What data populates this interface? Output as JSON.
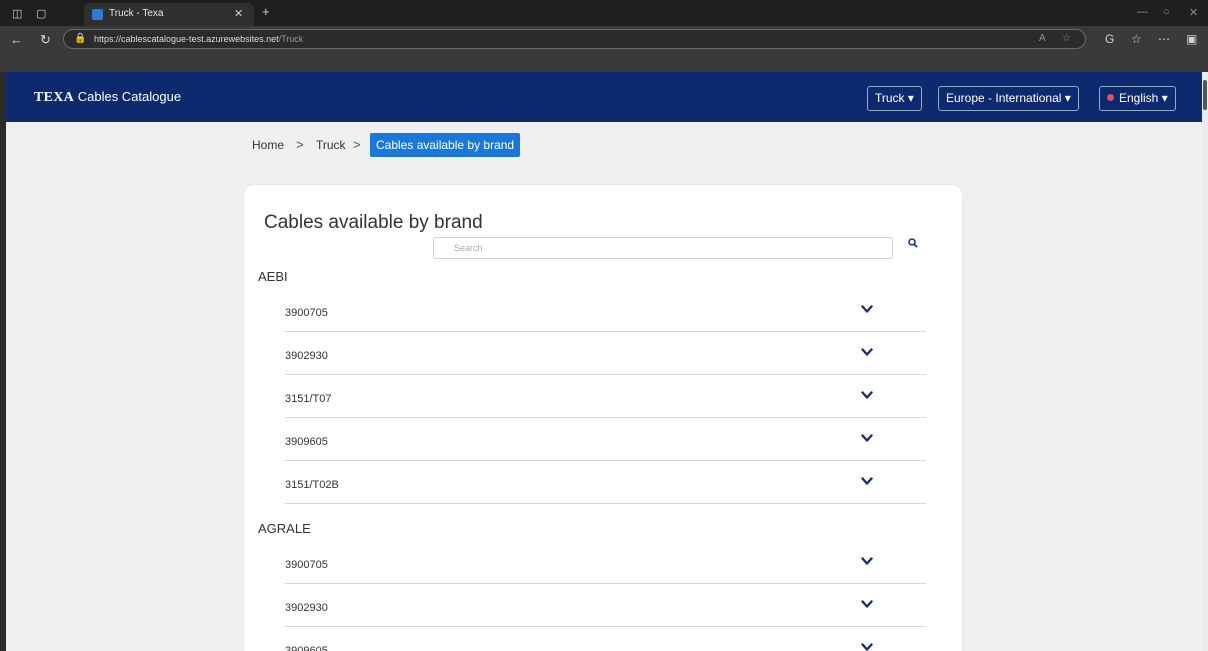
{
  "browser": {
    "tab_title": "Truck - Texa",
    "url_host": "https://cablescatalogue-test.azurewebsites.net",
    "url_path": "/Truck"
  },
  "header": {
    "brand_bold": "TEXA",
    "brand_rest": " Cables Catalogue",
    "vehicle_select": "Truck ▾",
    "region_select": "Europe - International ▾",
    "language_select": "English ▾"
  },
  "breadcrumb": {
    "home": "Home",
    "truck": "Truck",
    "separator": ">",
    "current": "Cables available by brand"
  },
  "card": {
    "title": "Cables available by brand",
    "search_placeholder": "Search"
  },
  "brands": [
    {
      "name": "AEBI",
      "cables": [
        "3900705",
        "3902930",
        "3151/T07",
        "3909605",
        "3151/T02B"
      ]
    },
    {
      "name": "AGRALE",
      "cables": [
        "3900705",
        "3902930",
        "3909605"
      ]
    }
  ],
  "colors": {
    "header_bg": "#0d2a6e",
    "accent": "#1a78d8",
    "chevron": "#1e2f66"
  }
}
